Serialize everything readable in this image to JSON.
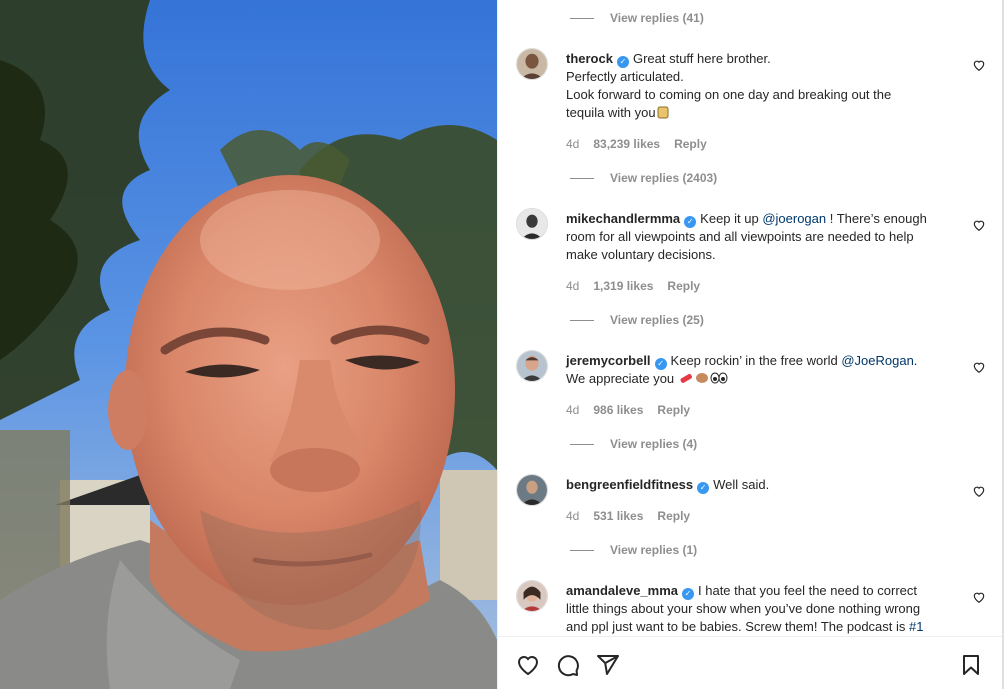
{
  "media": {
    "description_icon": "video-frame"
  },
  "comments_top": {
    "view_replies": "View replies (41)"
  },
  "comments": [
    {
      "username": "therock",
      "verified": true,
      "text_line1": "Great stuff here brother.",
      "text_line2": "Perfectly articulated.",
      "text_line3": "Look forward to coming on one day and breaking out the",
      "text_line4": "tequila with you",
      "time": "4d",
      "likes": "83,239 likes",
      "reply": "Reply",
      "view_replies": "View replies (2403)"
    },
    {
      "username": "mikechandlermma",
      "verified": true,
      "text_pre": "Keep it up ",
      "mention": "@joerogan",
      "text_post": " ! There’s enough",
      "text_line2": "room for all viewpoints and all viewpoints are needed to help",
      "text_line3": "make voluntary decisions.",
      "time": "4d",
      "likes": "1,319 likes",
      "reply": "Reply",
      "view_replies": "View replies (25)"
    },
    {
      "username": "jeremycorbell",
      "verified": true,
      "text_pre": "Keep rockin’ in the free world ",
      "mention": "@JoeRogan",
      "text_post": ".",
      "text_line2": "We appreciate you",
      "time": "4d",
      "likes": "986 likes",
      "reply": "Reply",
      "view_replies": "View replies (4)"
    },
    {
      "username": "bengreenfieldfitness",
      "verified": true,
      "text": "Well said.",
      "time": "4d",
      "likes": "531 likes",
      "reply": "Reply",
      "view_replies": "View replies (1)"
    },
    {
      "username": "amandaleve_mma",
      "verified": true,
      "text_line1": "I hate that you feel the need to correct",
      "text_line2": "little things about your show when you’ve done nothing wrong",
      "text_line3_pre": "and ppl just want to be babies. Screw them! The podcast is ",
      "text_line3_tag": "#1"
    }
  ],
  "icons": {
    "verified": "✓",
    "like": "heart-icon",
    "comment": "comment-icon",
    "share": "share-icon",
    "save": "bookmark-icon"
  },
  "colors": {
    "link": "#00376b",
    "muted": "#8e8e8e",
    "verified": "#3897f0"
  }
}
